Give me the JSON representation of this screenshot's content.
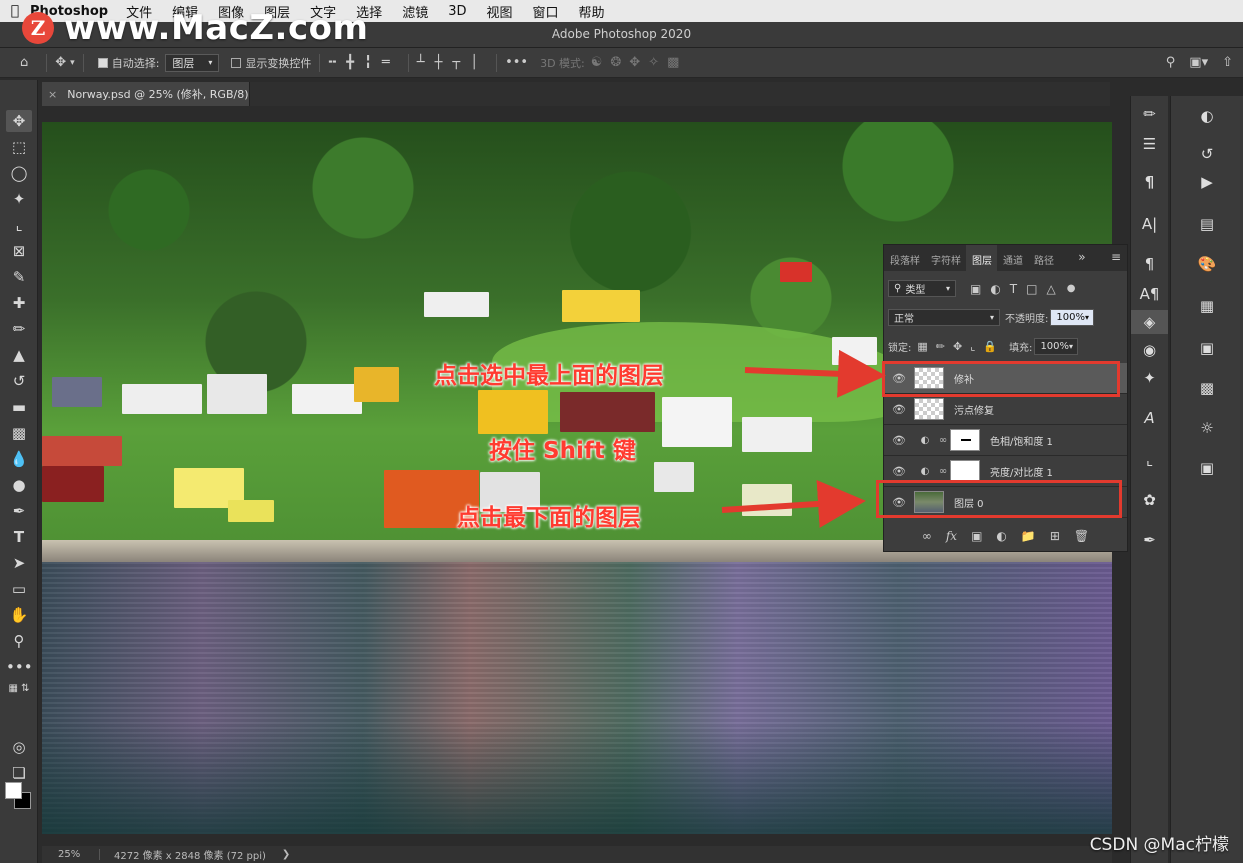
{
  "menubar": {
    "app_name": "Photoshop",
    "items": [
      "文件",
      "编辑",
      "图像",
      "图层",
      "文字",
      "选择",
      "滤镜",
      "3D",
      "视图",
      "窗口",
      "帮助"
    ]
  },
  "window": {
    "title": "Adobe Photoshop 2020"
  },
  "watermark": {
    "logo_letter": "Z",
    "text": "www.MacZ.com"
  },
  "options_bar": {
    "auto_select_label": "自动选择:",
    "auto_select_value": "图层",
    "transform_controls_label": "显示变换控件",
    "mode_3d_label": "3D 模式:"
  },
  "document_tab": {
    "label": "Norway.psd @ 25% (修补, RGB/8)"
  },
  "status_bar": {
    "zoom": "25%",
    "info": "4272 像素 x 2848 像素 (72 ppi)"
  },
  "layers_panel": {
    "tabs": [
      "段落样",
      "字符样",
      "图层",
      "通道",
      "路径"
    ],
    "active_tab": "图层",
    "filter_label": "类型",
    "blend_mode": "正常",
    "opacity_label": "不透明度:",
    "opacity_value": "100%",
    "lock_label": "锁定:",
    "fill_label": "填充:",
    "fill_value": "100%",
    "layers": [
      {
        "name": "修补",
        "type": "pixel",
        "selected": true
      },
      {
        "name": "污点修复",
        "type": "pixel",
        "selected": false
      },
      {
        "name": "色相/饱和度 1",
        "type": "adjustment",
        "selected": false
      },
      {
        "name": "亮度/对比度 1",
        "type": "adjustment",
        "selected": false
      },
      {
        "name": "图层 0",
        "type": "photo",
        "selected": false
      }
    ]
  },
  "annotations": {
    "top": "点击选中最上面的图层",
    "middle": "按住 Shift 键",
    "bottom": "点击最下面的图层"
  },
  "credit": "CSDN @Mac柠檬",
  "colors": {
    "annotation_red": "#ff3b30",
    "highlight_border": "#e33a2e"
  }
}
